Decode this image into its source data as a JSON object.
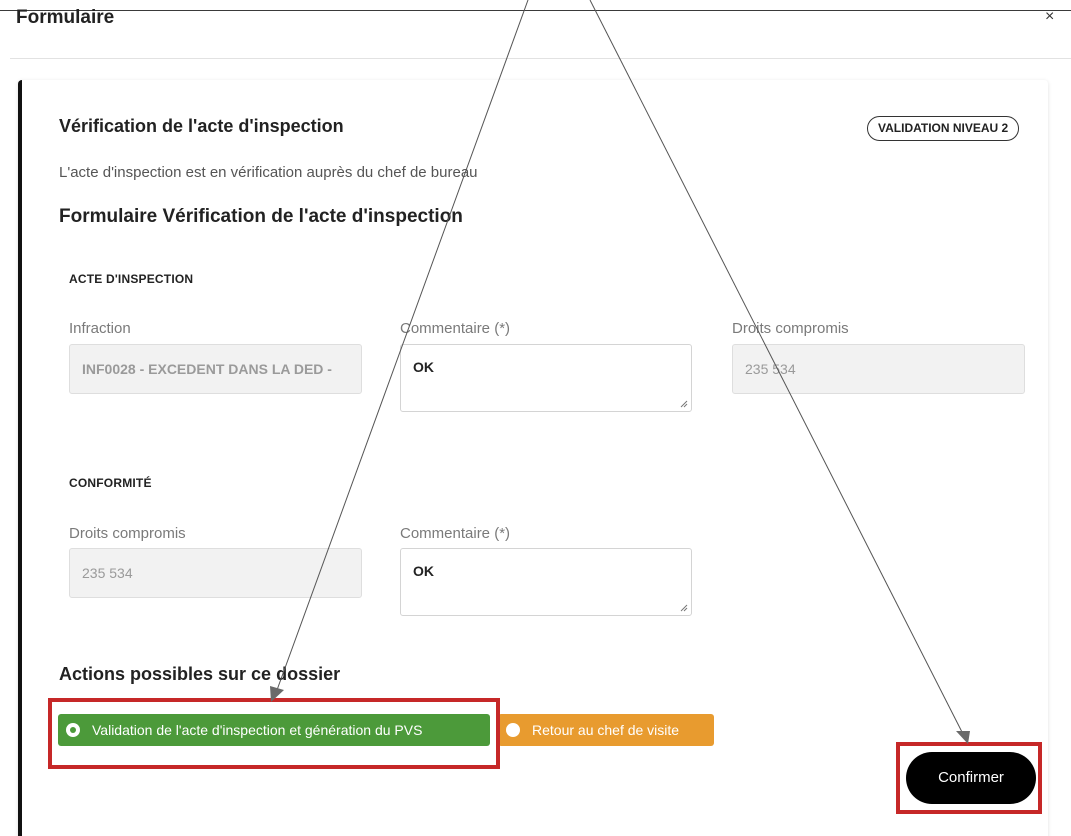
{
  "modal": {
    "title": "Formulaire",
    "close": "×"
  },
  "section": {
    "title": "Vérification de l'acte d'inspection",
    "badge": "VALIDATION NIVEAU 2",
    "subtitle": "L'acte d'inspection est en vérification auprès du chef de bureau",
    "form_title": "Formulaire Vérification de l'acte d'inspection"
  },
  "acte": {
    "heading": "ACTE D'INSPECTION",
    "infraction_label": "Infraction",
    "infraction_value": "INF0028 - EXCEDENT DANS LA DED - ",
    "comment_label": "Commentaire (*)",
    "comment_value": "OK",
    "droits_label": "Droits compromis",
    "droits_value": "235 534"
  },
  "conformite": {
    "heading": "CONFORMITÉ",
    "droits_label": "Droits compromis",
    "droits_value": "235 534",
    "comment_label": "Commentaire (*)",
    "comment_value": "OK"
  },
  "actions": {
    "title": "Actions possibles sur ce dossier",
    "options": [
      {
        "label": "Validation de l'acte d'inspection et génération du PVS",
        "selected": true,
        "color": "#4c9a3a"
      },
      {
        "label": "Retour au chef de visite",
        "selected": false,
        "color": "#e89b2f"
      }
    ],
    "confirm": "Confirmer"
  },
  "colors": {
    "highlight": "#c62828",
    "annotation_line": "#555555"
  }
}
